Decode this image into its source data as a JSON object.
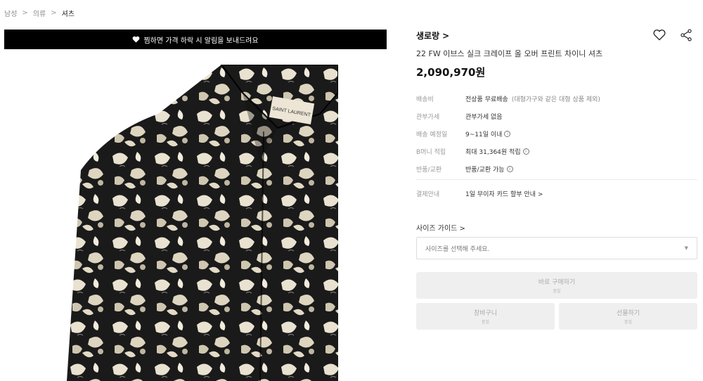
{
  "breadcrumb": {
    "items": [
      "남성",
      "의류",
      "셔츠"
    ],
    "separator": ">"
  },
  "banner": {
    "text": "찜하면 가격 하락 시 알림을 보내드려요",
    "icon": "heart-icon"
  },
  "product_image": {
    "alt": "Saint Laurent floral print shirt",
    "neck_label": "SAINT LAURENT"
  },
  "product": {
    "brand": "생로랑",
    "brand_chevron": ">",
    "title": "22 FW 이브스 실크 크레이프 올 오버 프린트 차이니 셔츠",
    "price": "2,090,970원"
  },
  "icons": {
    "wishlist": "heart-outline-icon",
    "share": "share-icon"
  },
  "details": [
    {
      "label": "배송비",
      "value": "전상품 무료배송",
      "note": "(대형가구와 같은 대형 상품 제외)",
      "info": false
    },
    {
      "label": "관부가세",
      "value": "관부가세 없음",
      "note": "",
      "info": false
    },
    {
      "label": "배송 예정일",
      "value": "9~11일 이내",
      "note": "",
      "info": true
    },
    {
      "label": "B머니 적립",
      "value": "최대 31,364원 적립",
      "note": "",
      "info": true
    },
    {
      "label": "반품/교환",
      "value": "반품/교환 가능",
      "note": "",
      "info": true
    }
  ],
  "payment": {
    "label": "결제안내",
    "value": "1일 무이자 카드 할부 안내 >"
  },
  "size": {
    "guide": "사이즈 가이드 >",
    "placeholder": "사이즈를 선택해 주세요.",
    "caret": "▼"
  },
  "buttons": {
    "buy_now": {
      "label": "바로 구매하기",
      "sub": "품절"
    },
    "cart": {
      "label": "장바구니",
      "sub": "품절"
    },
    "gift": {
      "label": "선물하기",
      "sub": "품절"
    }
  },
  "colors": {
    "banner_bg": "#000000",
    "button_bg": "#efefef",
    "disabled_text": "#aaaaaa"
  }
}
